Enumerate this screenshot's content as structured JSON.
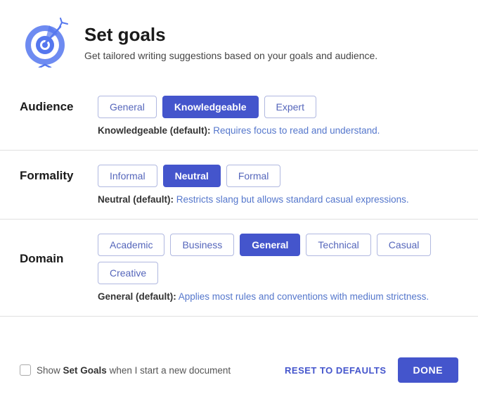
{
  "header": {
    "title": "Set goals",
    "subtitle": "Get tailored writing suggestions based on your goals and audience."
  },
  "audience": {
    "label": "Audience",
    "options": [
      "General",
      "Knowledgeable",
      "Expert"
    ],
    "active": "Knowledgeable",
    "description_label": "Knowledgeable (default):",
    "description_text": " Requires focus to read and understand."
  },
  "formality": {
    "label": "Formality",
    "options": [
      "Informal",
      "Neutral",
      "Formal"
    ],
    "active": "Neutral",
    "description_label": "Neutral (default):",
    "description_text": " Restricts slang but allows standard casual expressions."
  },
  "domain": {
    "label": "Domain",
    "options": [
      "Academic",
      "Business",
      "General",
      "Technical",
      "Casual",
      "Creative"
    ],
    "active": "General",
    "description_label": "General (default):",
    "description_text": " Applies most rules and conventions with medium strictness."
  },
  "footer": {
    "checkbox_label_pre": "Show ",
    "checkbox_label_bold": "Set Goals",
    "checkbox_label_post": " when I start a new document",
    "reset_label": "RESET TO DEFAULTS",
    "done_label": "DONE"
  }
}
